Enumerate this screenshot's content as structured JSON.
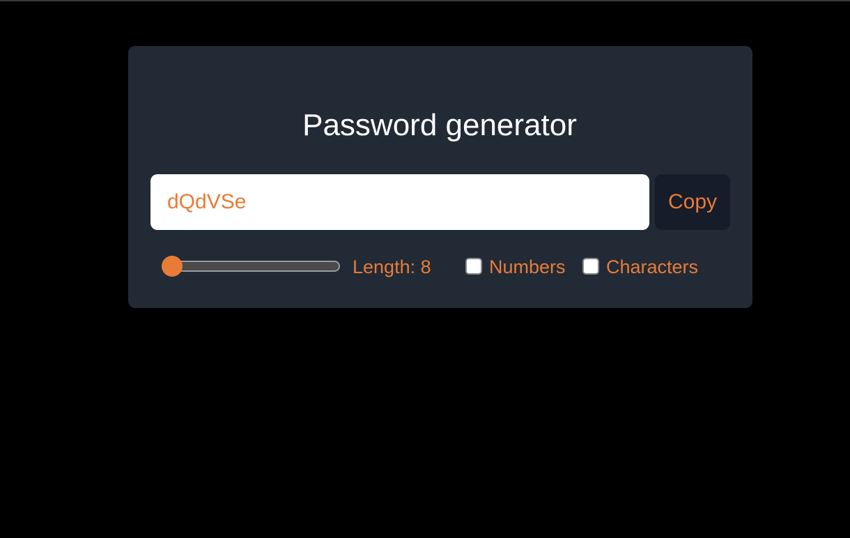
{
  "title": "Password generator",
  "password": {
    "value": "dQdVSe"
  },
  "copy_button": {
    "label": "Copy"
  },
  "length": {
    "label": "Length: 8",
    "value": 8
  },
  "options": {
    "numbers": {
      "label": "Numbers",
      "checked": false
    },
    "characters": {
      "label": "Characters",
      "checked": false
    }
  },
  "colors": {
    "background": "#000000",
    "card": "#222a36",
    "accent": "#e87c37",
    "button": "#161c29",
    "text": "#ffffff"
  }
}
